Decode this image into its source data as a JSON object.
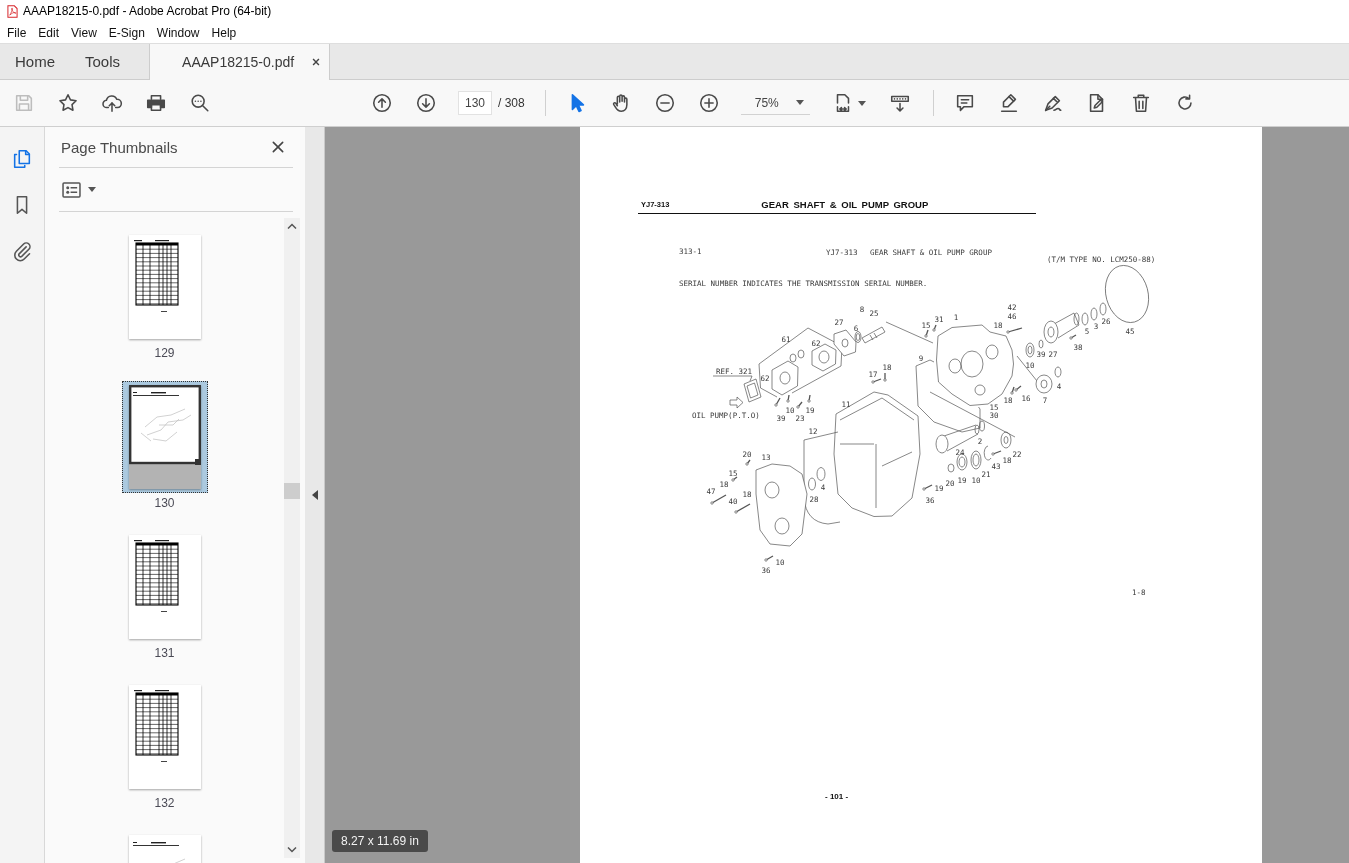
{
  "window": {
    "title": "AAAP18215-0.pdf - Adobe Acrobat Pro (64-bit)"
  },
  "menu": [
    "File",
    "Edit",
    "View",
    "E-Sign",
    "Window",
    "Help"
  ],
  "tabs": [
    {
      "label": "Home",
      "kind": "nav",
      "selected": false
    },
    {
      "label": "Tools",
      "kind": "nav",
      "selected": false
    },
    {
      "label": "AAAP18215-0.pdf",
      "kind": "document",
      "selected": true
    }
  ],
  "toolbar": {
    "file_tools": [
      {
        "kind": "save",
        "disabled": true
      },
      {
        "kind": "star",
        "disabled": false
      },
      {
        "kind": "upload",
        "disabled": false
      },
      {
        "kind": "print",
        "disabled": false
      },
      {
        "kind": "find",
        "disabled": false
      }
    ],
    "page_field": {
      "value": "130"
    },
    "page_total": "/ 308",
    "pointer_tools": [
      {
        "kind": "select",
        "selected": true
      },
      {
        "kind": "hand",
        "selected": false
      }
    ],
    "zoom_field": {
      "value": "75%"
    }
  },
  "nav_rail": [
    {
      "kind": "pages",
      "selected": true
    },
    {
      "kind": "bookmarks",
      "selected": false
    },
    {
      "kind": "attachments",
      "selected": false
    }
  ],
  "thumbnail_panel": {
    "title": "Page Thumbnails",
    "thumbnails": [
      {
        "label": "129",
        "kind": "table",
        "selected": false
      },
      {
        "label": "130",
        "kind": "diagram",
        "selected": true
      },
      {
        "label": "131",
        "kind": "table",
        "selected": false
      },
      {
        "label": "132",
        "kind": "table",
        "selected": false
      },
      {
        "kind": "diagram",
        "selected": false
      }
    ]
  },
  "page": {
    "header_code": "YJ7-313",
    "header_title": "GEAR SHAFT & OIL PUMP GROUP",
    "drawing": {
      "sheet_number": "313-1",
      "drawing_number": "YJ7-313",
      "drawing_title": "GEAR SHAFT & OIL PUMP GROUP",
      "type_note": "(T/M TYPE NO. LCM250-88)",
      "serial_note": "SERIAL NUMBER INDICATES THE TRANSMISSION SERIAL NUMBER.",
      "reference_label": "REF. 321",
      "pump_label": "OIL PUMP(P.T.O)",
      "callouts": [
        "8",
        "25",
        "42",
        "27",
        "31",
        "1",
        "46",
        "26",
        "6",
        "15",
        "18",
        "5",
        "3",
        "45",
        "61",
        "62",
        "38",
        "9",
        "39",
        "27",
        "18",
        "10",
        "62",
        "17",
        "4",
        "18",
        "16",
        "7",
        "10",
        "19",
        "11",
        "15",
        "39",
        "23",
        "30",
        "12",
        "2",
        "20",
        "13",
        "24",
        "22",
        "43",
        "18",
        "15",
        "21",
        "18",
        "20",
        "19",
        "10",
        "47",
        "4",
        "19",
        "40",
        "18",
        "28",
        "36",
        "10",
        "36"
      ],
      "sheet_code": "1-8"
    },
    "page_number": "- 101 -"
  },
  "page_size": "8.27 x 11.69 in"
}
